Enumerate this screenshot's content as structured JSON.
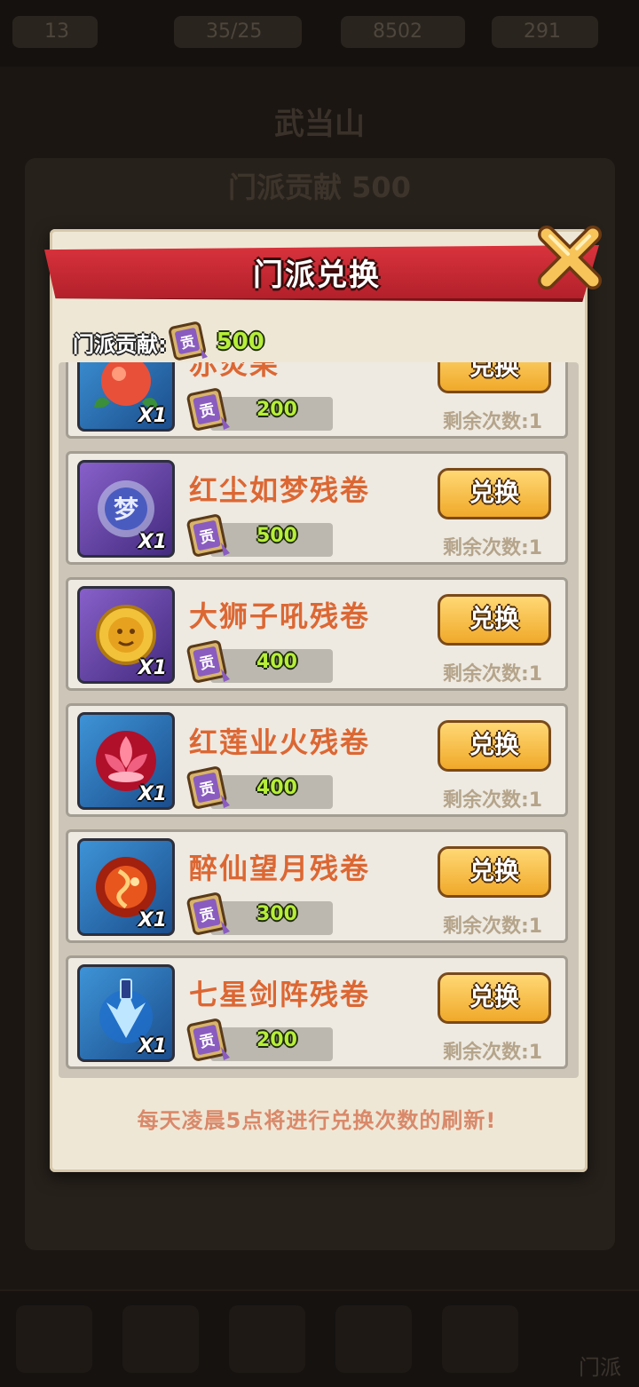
{
  "background": {
    "resources": [
      "13",
      "35/25",
      "8502",
      "291"
    ],
    "title": "武当山",
    "subtitle": "门派贡献 500",
    "description": "",
    "nav_label": "门派"
  },
  "dialog": {
    "title": "门派兑换",
    "contribution_label": "门派贡献:",
    "contribution_value": "500",
    "footer_note": "每天凌晨5点将进行兑换次数的刷新!"
  },
  "items": [
    {
      "name": "赤炎果",
      "quantity": "X1",
      "cost": "200",
      "button": "兑换",
      "remaining": "剩余次数:1",
      "icon": "fruit-icon",
      "frame": "blue"
    },
    {
      "name": "红尘如梦残卷",
      "quantity": "X1",
      "cost": "500",
      "button": "兑换",
      "remaining": "剩余次数:1",
      "icon": "dream-orb-icon",
      "frame": "purple"
    },
    {
      "name": "大狮子吼残卷",
      "quantity": "X1",
      "cost": "400",
      "button": "兑换",
      "remaining": "剩余次数:1",
      "icon": "lion-medallion-icon",
      "frame": "purple"
    },
    {
      "name": "红莲业火残卷",
      "quantity": "X1",
      "cost": "400",
      "button": "兑换",
      "remaining": "剩余次数:1",
      "icon": "lotus-icon",
      "frame": "blue"
    },
    {
      "name": "醉仙望月残卷",
      "quantity": "X1",
      "cost": "300",
      "button": "兑换",
      "remaining": "剩余次数:1",
      "icon": "fire-orb-icon",
      "frame": "blue"
    },
    {
      "name": "七星剑阵残卷",
      "quantity": "X1",
      "cost": "200",
      "button": "兑换",
      "remaining": "剩余次数:1",
      "icon": "sword-burst-icon",
      "frame": "blue"
    }
  ]
}
